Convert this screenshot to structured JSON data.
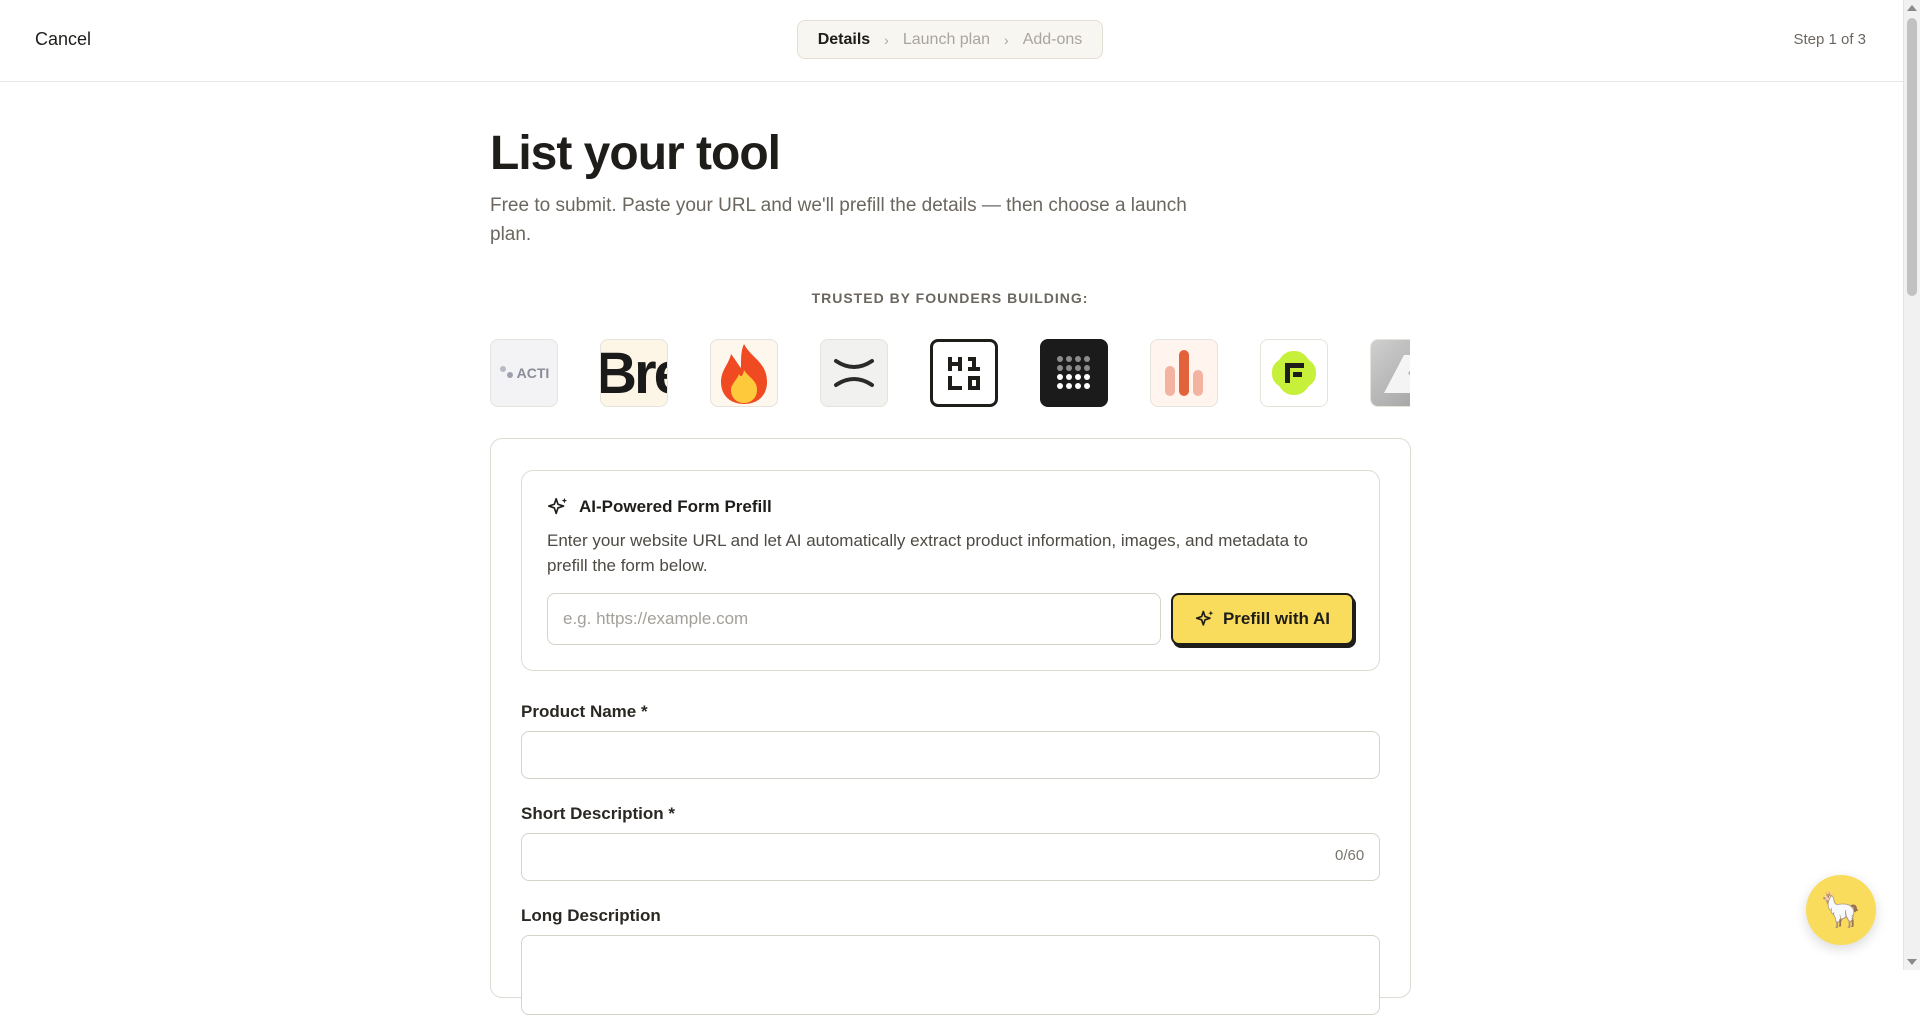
{
  "header": {
    "cancel_label": "Cancel",
    "steps": [
      {
        "label": "Details",
        "active": true
      },
      {
        "label": "Launch plan",
        "active": false
      },
      {
        "label": "Add-ons",
        "active": false
      }
    ],
    "step_counter": "Step 1 of 3"
  },
  "hero": {
    "title": "List your tool",
    "subtitle": "Free to submit. Paste your URL and we'll prefill the details — then choose a launch plan.",
    "trusted_label": "TRUSTED BY FOUNDERS BUILDING:"
  },
  "logos": [
    {
      "icon": "acti-logo",
      "text": "ACTI"
    },
    {
      "icon": "bre-logo",
      "text": "Bre"
    },
    {
      "icon": "fire-logo"
    },
    {
      "icon": "x-cross-logo"
    },
    {
      "icon": "klo-logo"
    },
    {
      "icon": "dot-grid-logo"
    },
    {
      "icon": "bar-chart-logo"
    },
    {
      "icon": "lime-f-logo"
    },
    {
      "icon": "grey-partial-logo"
    }
  ],
  "ai_prefill": {
    "title": "AI-Powered Form Prefill",
    "description": "Enter your website URL and let AI automatically extract product information, images, and metadata to prefill the form below.",
    "url_placeholder": "e.g. https://example.com",
    "url_value": "",
    "button_label": "Prefill with AI",
    "icon": "sparkles-icon"
  },
  "form": {
    "product_name_label": "Product Name *",
    "product_name_value": "",
    "short_description_label": "Short Description *",
    "short_description_value": "",
    "short_description_counter": "0/60",
    "long_description_label": "Long Description",
    "long_description_value": ""
  },
  "chat": {
    "icon": "llama-icon",
    "glyph": "🦙"
  },
  "colors": {
    "accent_yellow": "#f9dc5c",
    "text_primary": "#1f1d1a",
    "text_muted": "#6b6760",
    "border": "#dedbd3"
  }
}
